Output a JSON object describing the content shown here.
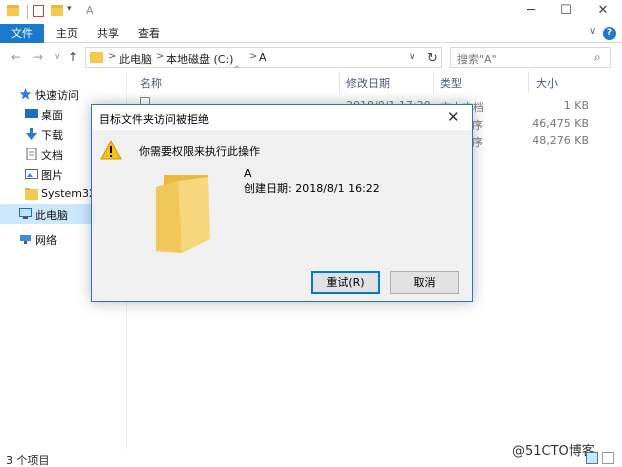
{
  "window": {
    "title": "A",
    "minimize_glyph": "─",
    "maximize_glyph": "☐",
    "close_glyph": "✕",
    "quick_access_arrow": "▾"
  },
  "ribbon": {
    "tabs": [
      "文件",
      "主页",
      "共享",
      "查看"
    ],
    "collapse_glyph": "∨",
    "help_glyph": "?"
  },
  "address": {
    "back": "←",
    "forward": "→",
    "dropdown": "∨",
    "up": "↑",
    "separator": ">",
    "parts": [
      "此电脑",
      "本地磁盘 (C:)",
      "A"
    ],
    "dropdown_glyph": "∨",
    "refresh_glyph": "↻",
    "search_placeholder": "搜索\"A\"",
    "search_glyph": "⌕"
  },
  "nav_pane": {
    "items": [
      {
        "label": "快速访问",
        "icon": "star-icon"
      },
      {
        "label": "桌面",
        "icon": "desktop-icon"
      },
      {
        "label": "下载",
        "icon": "download-icon"
      },
      {
        "label": "文档",
        "icon": "document-icon"
      },
      {
        "label": "图片",
        "icon": "picture-icon"
      },
      {
        "label": "System32",
        "icon": "folder-icon"
      },
      {
        "label": "此电脑",
        "icon": "computer-icon"
      },
      {
        "label": "网络",
        "icon": "network-icon"
      }
    ]
  },
  "file_list": {
    "sort_glyph": "^",
    "columns": [
      "名称",
      "修改日期",
      "类型",
      "大小"
    ],
    "rows": [
      {
        "date": "2018/8/1 17:20",
        "type": "文本文档",
        "size": "1 KB"
      },
      {
        "date": "",
        "type": "序",
        "size": "46,475 KB"
      },
      {
        "date": "",
        "type": "序",
        "size": "48,276 KB"
      }
    ]
  },
  "status": {
    "item_count": "3 个项目",
    "watermark": "@51CTO博客"
  },
  "dialog": {
    "title": "目标文件夹访问被拒绝",
    "close_glyph": "✕",
    "message": "你需要权限来执行此操作",
    "folder_name": "A",
    "created": "创建日期: 2018/8/1 16:22",
    "retry_label": "重试(R)",
    "cancel_label": "取消"
  },
  "colors": {
    "accent": "#1979ca",
    "selection": "#cce8ff",
    "dialog_border": "#2b73c5",
    "folder": "#f3c94f"
  }
}
